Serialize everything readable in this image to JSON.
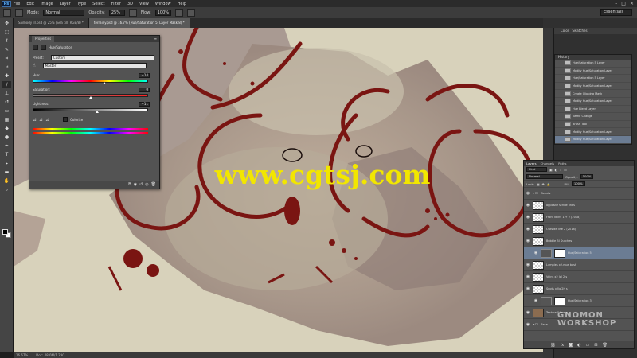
{
  "menubar": {
    "logo": "Ps",
    "items": [
      "File",
      "Edit",
      "Image",
      "Layer",
      "Type",
      "Select",
      "Filter",
      "3D",
      "View",
      "Window",
      "Help"
    ],
    "workspace": "Essentials"
  },
  "options": {
    "mode_label": "Mode:",
    "mode_value": "Normal",
    "opacity_label": "Opacity:",
    "opacity_value": "25%",
    "flow_label": "Flow:",
    "flow_value": "100%"
  },
  "tabs": [
    {
      "label": "Sailbody ill.psd @ 25% (Sea till, RGB/8) *",
      "active": false
    },
    {
      "label": "terrainy.psd @ 16.7% (Hue/Saturation 5, Layer Mask/8) *",
      "active": true
    }
  ],
  "properties": {
    "tab_left": "Properties",
    "title": "Hue/Saturation",
    "preset_label": "Preset:",
    "preset_value": "Custom",
    "channel_value": "Master",
    "hue_label": "Hue:",
    "hue_value": "+14",
    "hue_level": 0.62,
    "saturation_label": "Saturation:",
    "saturation_value": "0",
    "saturation_level": 0.5,
    "lightness_label": "Lightness:",
    "lightness_value": "+11",
    "lightness_level": 0.56,
    "colorize_label": "Colorize"
  },
  "dock_tabs": [
    "Color",
    "Swatches"
  ],
  "history": {
    "title": "History",
    "items": [
      "Hue/Saturation 5 Layer",
      "Modify Hue/Saturation Layer",
      "Hue/Saturation 5 Layer",
      "Modify Hue/Saturation Layer",
      "Create Clipping Mask",
      "Modify Hue/Saturation Layer",
      "Hue Bleed Layer",
      "Name Change",
      "Brush Tool",
      "Modify Hue/Saturation Layer",
      "Modify Hue/Saturation Layer"
    ],
    "selected_index": 10
  },
  "layers": {
    "tabs": [
      "Layers",
      "Channels",
      "Paths"
    ],
    "kind_label": "Kind",
    "blend_mode": "Normal",
    "opacity_label": "Opacity:",
    "opacity_value": "100%",
    "lock_label": "Lock:",
    "fill_label": "Fill:",
    "fill_value": "100%",
    "rows": [
      {
        "name": "Details",
        "type": "folder"
      },
      {
        "name": "opposite scribe lines",
        "type": "pixel"
      },
      {
        "name": "Front veins 1 + 2 (2018)",
        "type": "pixel"
      },
      {
        "name": "Outside line 2 (2018)",
        "type": "pixel"
      },
      {
        "name": "Bubble Bl Dutches",
        "type": "pixel"
      },
      {
        "name": "Hue/Saturation 5",
        "type": "adjustment"
      },
      {
        "name": "Lumpies x2.mus bash",
        "type": "pixel"
      },
      {
        "name": "Veins x2 lol 2 s",
        "type": "pixel"
      },
      {
        "name": "Spots x2lol2h s",
        "type": "pixel"
      },
      {
        "name": "Hue/Saturation 3",
        "type": "adjustment"
      },
      {
        "name": "Texture 0 hue s",
        "type": "texture"
      },
      {
        "name": "Base",
        "type": "folder"
      }
    ],
    "selected_index": 5
  },
  "status": {
    "zoom": "16.67%",
    "doc": "Doc: 48.0M/1.23G"
  },
  "watermark": "www.cgtsj.com",
  "brand_logo": [
    "GNOMON",
    "WORKSHOP"
  ]
}
